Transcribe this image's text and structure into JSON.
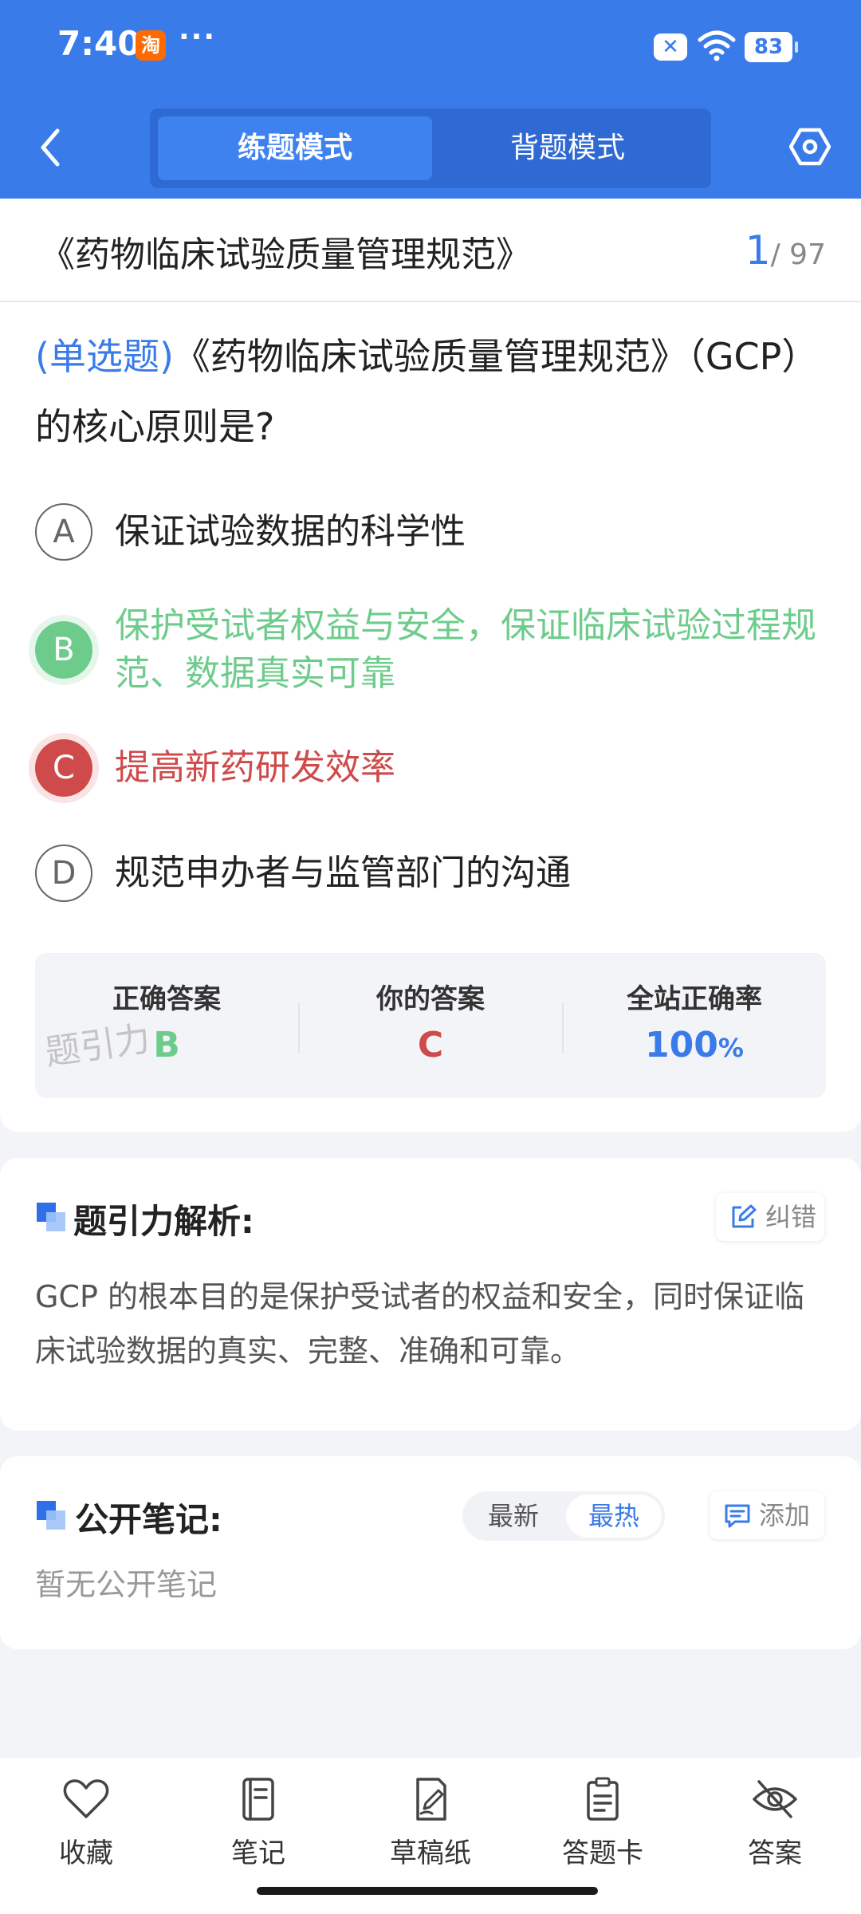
{
  "status_bar": {
    "time": "7:40",
    "app_badge": "淘",
    "more": "···",
    "battery": "83"
  },
  "header": {
    "tabs": [
      {
        "label": "练题模式",
        "active": true
      },
      {
        "label": "背题模式",
        "active": false
      }
    ]
  },
  "title_bar": {
    "title": "《药物临床试验质量管理规范》",
    "current": "1",
    "total": "/ 97"
  },
  "question": {
    "type": "(单选题)",
    "text": "《药物临床试验质量管理规范》（GCP）的核心原则是?",
    "options": [
      {
        "letter": "A",
        "text": "保证试验数据的科学性",
        "state": "normal"
      },
      {
        "letter": "B",
        "text": "保护受试者权益与安全，保证临床试验过程规范、数据真实可靠",
        "state": "correct"
      },
      {
        "letter": "C",
        "text": "提高新药研发效率",
        "state": "wrong"
      },
      {
        "letter": "D",
        "text": "规范申办者与监管部门的沟通",
        "state": "normal"
      }
    ]
  },
  "stats": {
    "correct_label": "正确答案",
    "correct_value": "B",
    "yours_label": "你的答案",
    "yours_value": "C",
    "rate_label": "全站正确率",
    "rate_value": "100",
    "rate_unit": "%",
    "watermark": "题引力"
  },
  "analysis": {
    "title": "题引力解析:",
    "report_label": "纠错",
    "text": "GCP 的根本目的是保护受试者的权益和安全，同时保证临床试验数据的真实、完整、准确和可靠。"
  },
  "notes": {
    "title": "公开笔记:",
    "sort_options": [
      "最新",
      "最热"
    ],
    "sort_selected": "最热",
    "add_label": "添加",
    "empty_text": "暂无公开笔记"
  },
  "bottom_bar": [
    {
      "label": "收藏",
      "icon": "heart-icon"
    },
    {
      "label": "笔记",
      "icon": "notebook-icon"
    },
    {
      "label": "草稿纸",
      "icon": "draft-paper-icon"
    },
    {
      "label": "答题卡",
      "icon": "answer-sheet-icon"
    },
    {
      "label": "答案",
      "icon": "eye-off-icon"
    }
  ],
  "colors": {
    "brand": "#3a7bea",
    "correct": "#6dcc8b",
    "wrong": "#cf4a4a"
  }
}
